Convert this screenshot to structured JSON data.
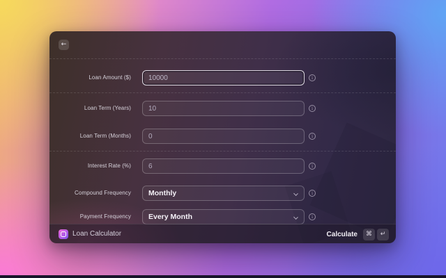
{
  "window": {
    "header": {
      "back_label": "←"
    },
    "form": {
      "fields": [
        {
          "label": "Loan Amount ($)",
          "value": "10000",
          "type": "input",
          "focused": true
        },
        {
          "label": "Loan Term (Years)",
          "value": "10",
          "type": "input",
          "focused": false
        },
        {
          "label": "Loan Term (Months)",
          "value": "0",
          "type": "input",
          "focused": false
        },
        {
          "label": "Interest Rate (%)",
          "value": "6",
          "type": "input",
          "focused": false
        },
        {
          "label": "Compound Frequency",
          "value": "Monthly",
          "type": "dropdown",
          "focused": false
        },
        {
          "label": "Payment Frequency",
          "value": "Every Month",
          "type": "dropdown",
          "focused": false
        }
      ]
    },
    "action_bar": {
      "app_name": "Loan Calculator",
      "primary_action": "Calculate",
      "shortcut_keys": [
        "⌘",
        "↵"
      ]
    }
  },
  "colors": {
    "accent_focus_ring": "#eeeaf2",
    "app_icon_gradient_start": "#f06ad6",
    "app_icon_gradient_end": "#7e54ef",
    "desktop_yellow": "#f6da5c",
    "desktop_pink": "#fb79d8",
    "desktop_blue": "#60a4f4",
    "desktop_indigo": "#6e66ea"
  }
}
